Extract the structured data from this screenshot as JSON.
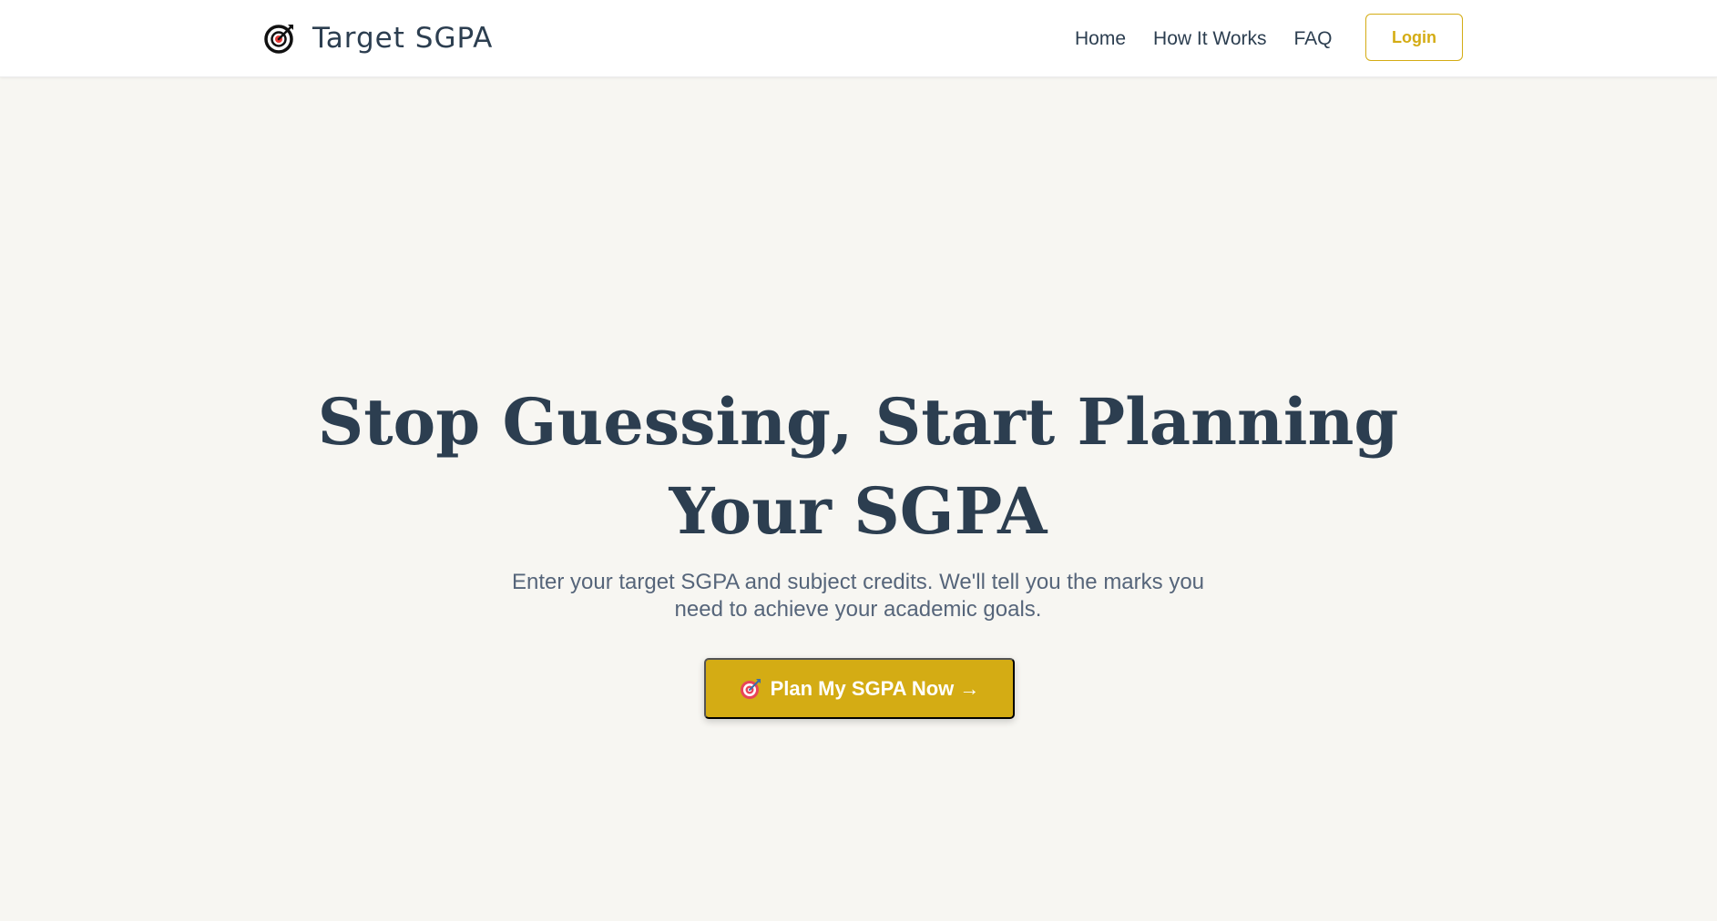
{
  "header": {
    "brand": {
      "title": "Target SGPA",
      "icon": "target-icon"
    },
    "nav_items": [
      {
        "label": "Home"
      },
      {
        "label": "How It Works"
      },
      {
        "label": "FAQ"
      }
    ],
    "login_label": "Login"
  },
  "hero": {
    "title": "Stop Guessing, Start Planning Your SGPA",
    "subtitle": "Enter your target SGPA and subject credits. We'll tell you the marks you need to achieve your academic goals.",
    "cta": {
      "icon": "direct-hit-icon",
      "label": "Plan My SGPA Now →"
    }
  },
  "colors": {
    "accent": "#d4ac14",
    "heading": "#2c3e50",
    "body_text": "#56657a",
    "background": "#f7f6f2",
    "navbar": "#ffffff"
  }
}
